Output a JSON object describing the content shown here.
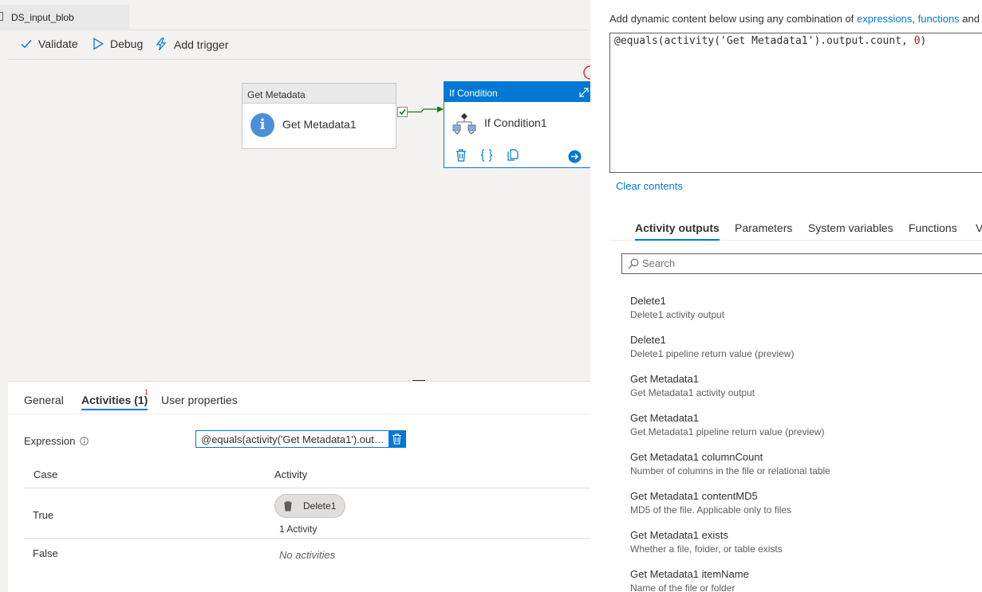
{
  "tab": {
    "title": "DS_input_blob"
  },
  "toolbar": {
    "validate": "Validate",
    "debug": "Debug",
    "add_trigger": "Add trigger"
  },
  "canvas": {
    "get_metadata": {
      "header": "Get Metadata",
      "name": "Get Metadata1"
    },
    "if_condition": {
      "header": "If Condition",
      "name": "If Condition1"
    }
  },
  "bottom": {
    "tabs": [
      "General",
      "Activities (1)",
      "User properties"
    ],
    "activities_badge": "1",
    "expression_label": "Expression",
    "expression_value": "@equals(activity('Get Metadata1').output.count, 0)",
    "table": {
      "headers": [
        "Case",
        "Activity"
      ],
      "rows": [
        {
          "case": "True",
          "chip": "Delete1",
          "count": "1 Activity"
        },
        {
          "case": "False",
          "empty": "No activities"
        }
      ]
    }
  },
  "panel": {
    "hint_prefix": "Add dynamic content below using any combination of ",
    "hint_link1": "expressions",
    "hint_sep": ", ",
    "hint_link2": "functions",
    "hint_suffix": " and",
    "editor_pre": "@equals(activity('Get Metadata1').output.count, ",
    "editor_num": "0",
    "editor_post": ")",
    "clear": "Clear contents",
    "tabs": [
      "Activity outputs",
      "Parameters",
      "System variables",
      "Functions",
      "V"
    ],
    "search_placeholder": "Search",
    "items": [
      {
        "title": "Delete1",
        "desc": "Delete1 activity output"
      },
      {
        "title": "Delete1",
        "desc": "Delete1 pipeline return value (preview)"
      },
      {
        "title": "Get Metadata1",
        "desc": "Get Metadata1 activity output"
      },
      {
        "title": "Get Metadata1",
        "desc": "Get Metadata1 pipeline return value (preview)"
      },
      {
        "title": "Get Metadata1 columnCount",
        "desc": "Number of columns in the file or relational table"
      },
      {
        "title": "Get Metadata1 contentMD5",
        "desc": "MD5 of the file. Applicable only to files"
      },
      {
        "title": "Get Metadata1 exists",
        "desc": "Whether a file, folder, or table exists"
      },
      {
        "title": "Get Metadata1 itemName",
        "desc": "Name of the file or folder"
      }
    ]
  },
  "colors": {
    "accent": "#0078d4",
    "success": "#107c10"
  }
}
